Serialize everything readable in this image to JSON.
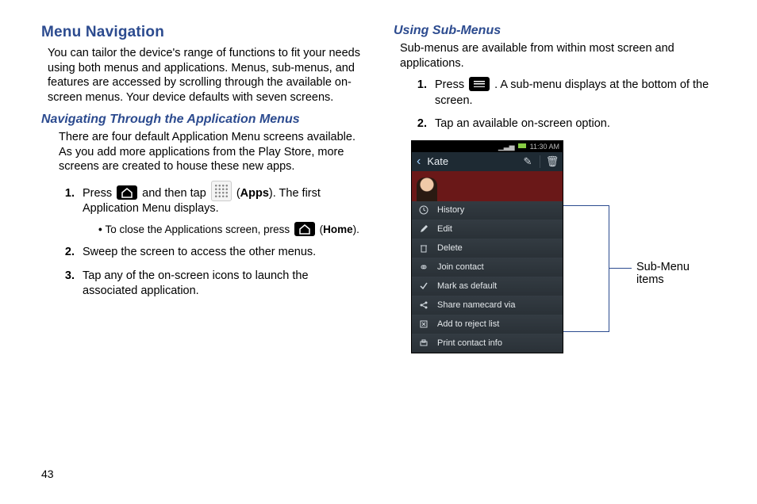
{
  "page_number": "43",
  "left": {
    "h2": "Menu Navigation",
    "intro": "You can tailor the device's range of functions to fit your needs using both menus and applications. Menus, sub-menus, and features are accessed by scrolling through the available on-screen menus. Your device defaults with seven screens.",
    "h3": "Navigating Through the Application Menus",
    "p2": "There are four default Application Menu screens available. As you add more applications from the Play Store, more screens are created to house these new apps.",
    "step1a": "Press ",
    "step1b": " and then tap ",
    "step1c": " (",
    "apps_label": "Apps",
    "step1d": "). The first Application Menu displays.",
    "bullet_a": "To close the Applications screen, press ",
    "bullet_b": " (",
    "home_label": "Home",
    "bullet_c": ").",
    "step2": "Sweep the screen to access the other menus.",
    "step3": "Tap any of the on-screen icons to launch the associated application."
  },
  "right": {
    "h3": "Using Sub-Menus",
    "intro": "Sub-menus are available from within most screen and applications.",
    "step1a": "Press ",
    "step1b": ". A sub-menu displays at the bottom of the screen.",
    "step2": "Tap an available on-screen option."
  },
  "phone": {
    "time": "11:30 AM",
    "name": "Kate",
    "items": [
      "History",
      "Edit",
      "Delete",
      "Join contact",
      "Mark as default",
      "Share namecard via",
      "Add to reject list",
      "Print contact info"
    ]
  },
  "callout_label": "Sub-Menu items"
}
